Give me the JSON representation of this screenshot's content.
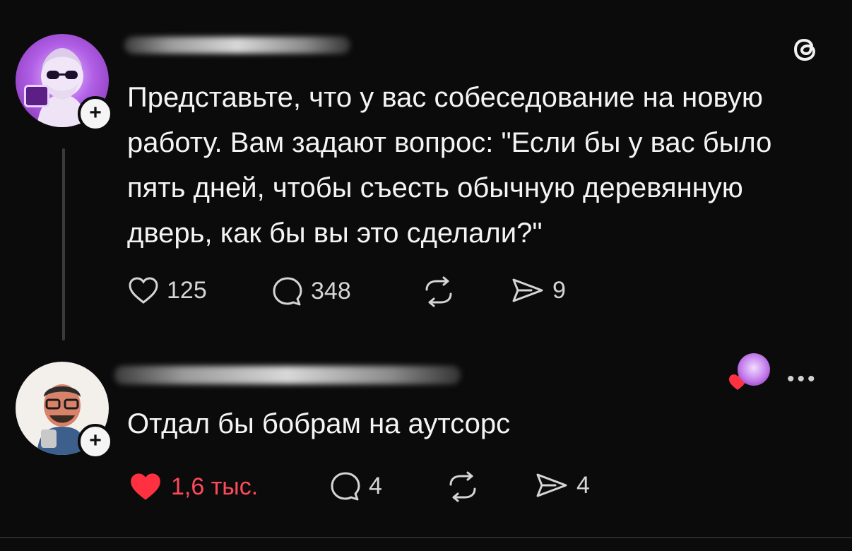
{
  "post": {
    "text": "Представьте, что у вас собеседование на новую работу. Вам задают вопрос: \"Если бы у вас было пять дней, чтобы съесть обычную деревянную дверь, как бы вы это сделали?\"",
    "likes": "125",
    "comments": "348",
    "shares": "9"
  },
  "reply": {
    "text": "Отдал бы бобрам на аутсорс",
    "likes": "1,6 тыс.",
    "comments": "4",
    "shares": "4"
  },
  "colors": {
    "background": "#0b0b0c",
    "heart_liked": "#ff3040"
  }
}
